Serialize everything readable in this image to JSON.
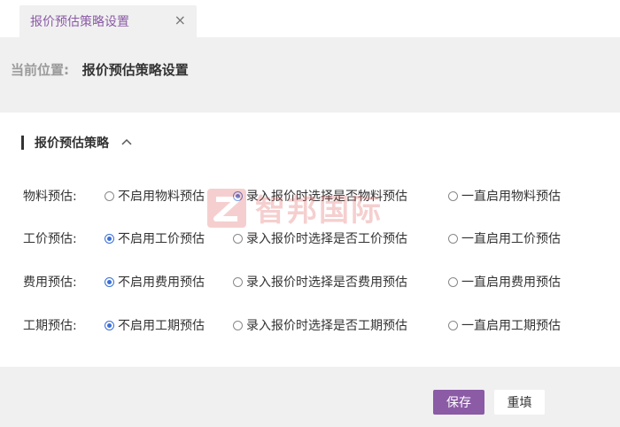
{
  "tab": {
    "title": "报价预估策略设置",
    "close": "×"
  },
  "breadcrumb": {
    "label": "当前位置:",
    "value": "报价预估策略设置"
  },
  "section": {
    "title": "报价预估策略",
    "collapse_icon": "chevron-up-icon"
  },
  "rows": [
    {
      "label": "物料预估:",
      "options": [
        "不启用物料预估",
        "录入报价时选择是否物料预估",
        "一直启用物料预估"
      ],
      "selected": 1
    },
    {
      "label": "工价预估:",
      "options": [
        "不启用工价预估",
        "录入报价时选择是否工价预估",
        "一直启用工价预估"
      ],
      "selected": 0
    },
    {
      "label": "费用预估:",
      "options": [
        "不启用费用预估",
        "录入报价时选择是否费用预估",
        "一直启用费用预估"
      ],
      "selected": 0
    },
    {
      "label": "工期预估:",
      "options": [
        "不启用工期预估",
        "录入报价时选择是否工期预估",
        "一直启用工期预估"
      ],
      "selected": 0
    }
  ],
  "watermark": {
    "text": "智邦国际"
  },
  "buttons": {
    "save": "保存",
    "reset": "重填"
  },
  "colors": {
    "accent": "#8b5ba6",
    "radio_selected": "#3a6fd8",
    "watermark": "#e26b6b"
  }
}
